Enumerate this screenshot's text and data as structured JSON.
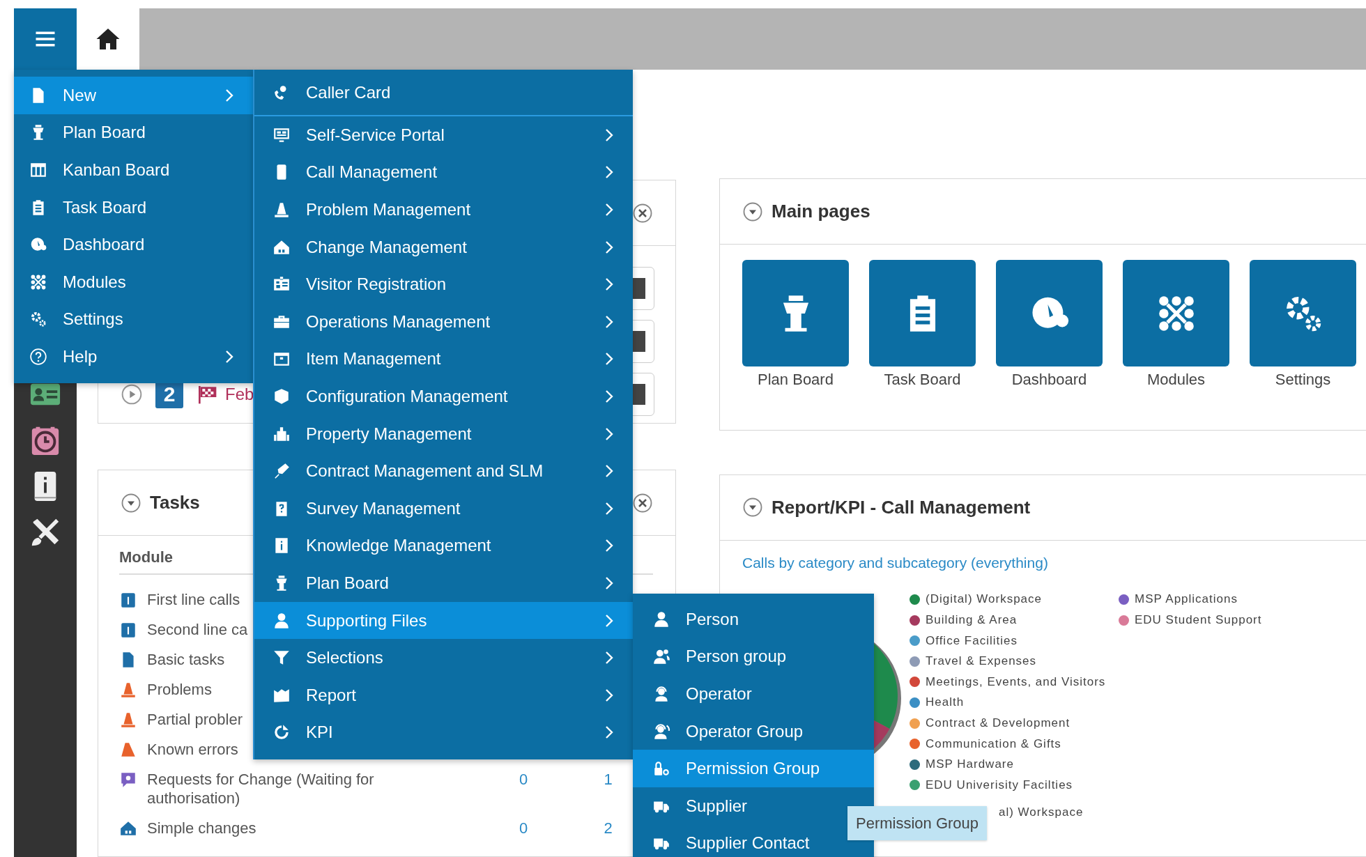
{
  "main_menu": {
    "items": [
      {
        "label": "New",
        "selected": true,
        "has_submenu": true
      },
      {
        "label": "Plan Board",
        "selected": false,
        "has_submenu": false
      },
      {
        "label": "Kanban Board",
        "selected": false,
        "has_submenu": false
      },
      {
        "label": "Task Board",
        "selected": false,
        "has_submenu": false
      },
      {
        "label": "Dashboard",
        "selected": false,
        "has_submenu": false
      },
      {
        "label": "Modules",
        "selected": false,
        "has_submenu": false
      },
      {
        "label": "Settings",
        "selected": false,
        "has_submenu": false
      },
      {
        "label": "Help",
        "selected": false,
        "has_submenu": true
      }
    ]
  },
  "new_submenu": {
    "items": [
      {
        "label": "Caller Card",
        "selected": false,
        "has_submenu": false
      },
      {
        "label": "Self-Service Portal",
        "selected": false,
        "has_submenu": true
      },
      {
        "label": "Call Management",
        "selected": false,
        "has_submenu": true
      },
      {
        "label": "Problem Management",
        "selected": false,
        "has_submenu": true
      },
      {
        "label": "Change Management",
        "selected": false,
        "has_submenu": true
      },
      {
        "label": "Visitor Registration",
        "selected": false,
        "has_submenu": true
      },
      {
        "label": "Operations Management",
        "selected": false,
        "has_submenu": true
      },
      {
        "label": "Item Management",
        "selected": false,
        "has_submenu": true
      },
      {
        "label": "Configuration Management",
        "selected": false,
        "has_submenu": true
      },
      {
        "label": "Property Management",
        "selected": false,
        "has_submenu": true
      },
      {
        "label": "Contract Management and SLM",
        "selected": false,
        "has_submenu": true
      },
      {
        "label": "Survey Management",
        "selected": false,
        "has_submenu": true
      },
      {
        "label": "Knowledge Management",
        "selected": false,
        "has_submenu": true
      },
      {
        "label": "Plan Board",
        "selected": false,
        "has_submenu": true
      },
      {
        "label": "Supporting Files",
        "selected": true,
        "has_submenu": true
      },
      {
        "label": "Selections",
        "selected": false,
        "has_submenu": true
      },
      {
        "label": "Report",
        "selected": false,
        "has_submenu": true
      },
      {
        "label": "KPI",
        "selected": false,
        "has_submenu": true
      }
    ]
  },
  "supporting_files_submenu": {
    "items": [
      {
        "label": "Person",
        "selected": false
      },
      {
        "label": "Person group",
        "selected": false
      },
      {
        "label": "Operator",
        "selected": false
      },
      {
        "label": "Operator Group",
        "selected": false
      },
      {
        "label": "Permission Group",
        "selected": true
      },
      {
        "label": "Supplier",
        "selected": false
      },
      {
        "label": "Supplier Contact",
        "selected": false
      }
    ]
  },
  "tooltip": {
    "text": "Permission Group"
  },
  "schedule_panel": {
    "badge": "2",
    "date": "Feb"
  },
  "tasks_panel": {
    "title": "Tasks",
    "expanded": true,
    "column_header": "Module",
    "rows": [
      {
        "module": "First line calls"
      },
      {
        "module": "Second line ca"
      },
      {
        "module": "Basic tasks"
      },
      {
        "module": "Problems"
      },
      {
        "module": "Partial probler"
      },
      {
        "module": "Known errors"
      },
      {
        "module": "Requests for Change (Waiting for authorisation)",
        "values": [
          "0",
          "1"
        ]
      },
      {
        "module": "Simple changes",
        "values": [
          "0",
          "2"
        ]
      }
    ]
  },
  "main_pages": {
    "title": "Main pages",
    "expanded": true,
    "tiles": [
      {
        "label": "Plan Board"
      },
      {
        "label": "Task Board"
      },
      {
        "label": "Dashboard"
      },
      {
        "label": "Modules"
      },
      {
        "label": "Settings"
      }
    ]
  },
  "report_panel": {
    "title": "Report/KPI - Call Management",
    "expanded": true,
    "link": "Calls by category and subcategory (everything)",
    "legend": [
      {
        "label": "(Digital) Workspace",
        "color": "#1e8a4c"
      },
      {
        "label": "Building & Area",
        "color": "#a53a5e"
      },
      {
        "label": "Office Facilities",
        "color": "#4a9cc9"
      },
      {
        "label": "Travel & Expenses",
        "color": "#8e9bb5"
      },
      {
        "label": "Meetings, Events, and Visitors",
        "color": "#d2473a"
      },
      {
        "label": "Health",
        "color": "#3b8fc4"
      },
      {
        "label": "Contract & Development",
        "color": "#f0a050"
      },
      {
        "label": "Communication & Gifts",
        "color": "#e8622c"
      },
      {
        "label": "MSP Hardware",
        "color": "#2c6b7c"
      },
      {
        "label": "EDU Univerisity Facilties",
        "color": "#3aa070"
      },
      {
        "label": "MSP Applications",
        "color": "#7a5fc2"
      },
      {
        "label": "EDU Student Support",
        "color": "#d97a98"
      }
    ],
    "legend_cut_off": "al) Workspace"
  }
}
